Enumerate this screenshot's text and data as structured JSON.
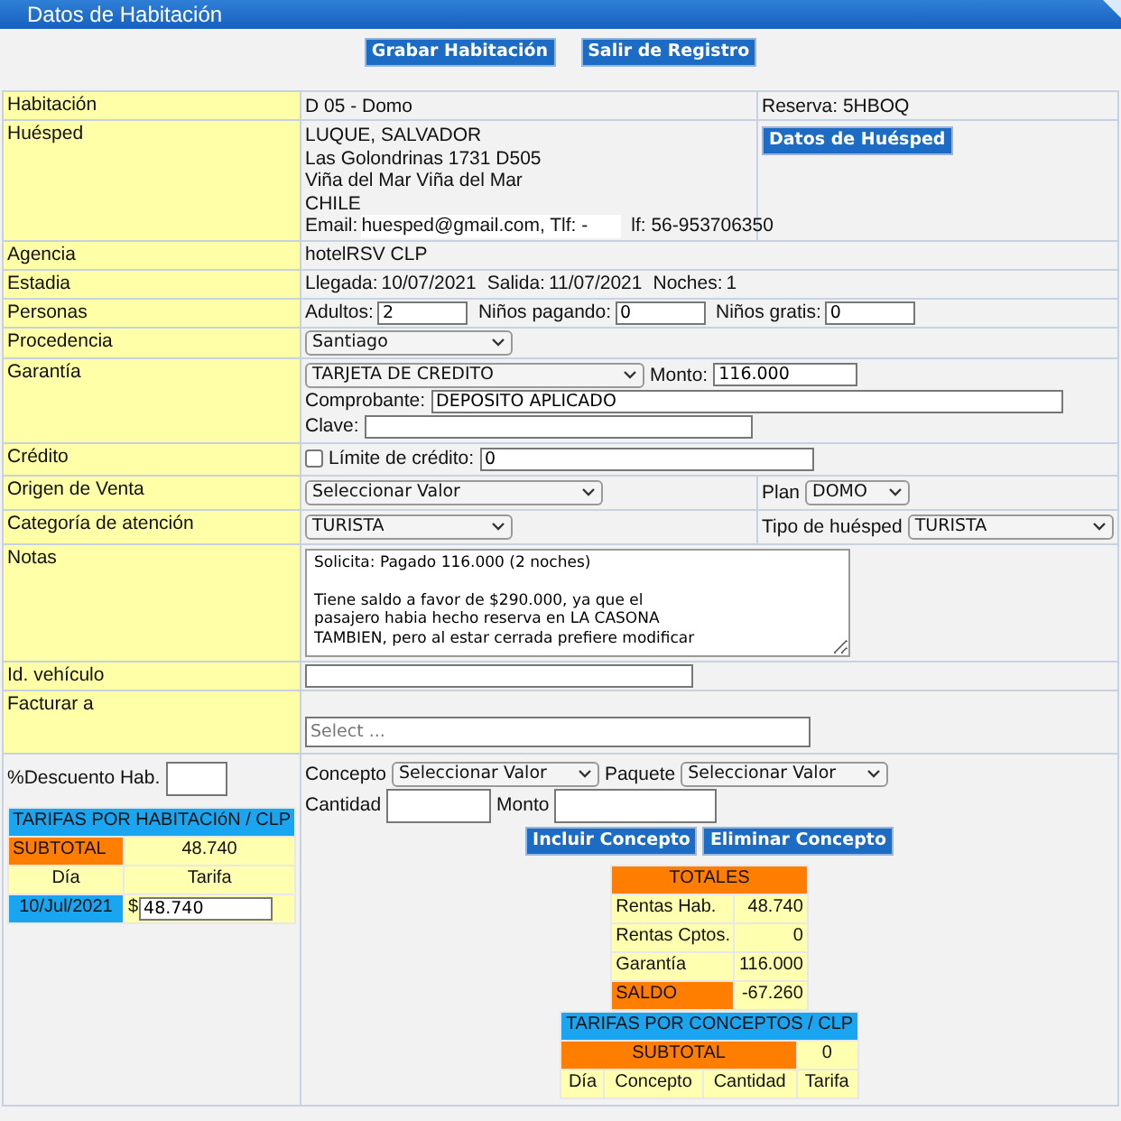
{
  "window": {
    "title": "Datos de Habitación"
  },
  "toolbar": {
    "buttons": [
      "Grabar Habitación",
      "Salir de Registro"
    ]
  },
  "habitacion": {
    "label": "Habitación",
    "value": "D 05 - Domo",
    "reserva_label": "Reserva:",
    "reserva": "5HBOQ"
  },
  "huesped": {
    "label": "Huésped",
    "lines": [
      "LUQUE, SALVADOR",
      "Las Golondrinas 1731 D505",
      "Viña del Mar Viña del Mar",
      "CHILE"
    ],
    "email_label": "Email:",
    "email": "huesped@gmail.com, Tlf: -",
    "phone": "lf: 56-953706350",
    "button": "Datos de Huésped"
  },
  "agencia": {
    "label": "Agencia",
    "value": "hotelRSV CLP"
  },
  "estadia": {
    "label": "Estadia",
    "items": [
      {
        "label": "Llegada:",
        "value": "10/07/2021"
      },
      {
        "label": "Salida:",
        "value": "11/07/2021"
      },
      {
        "label": "Noches:",
        "value": "1"
      }
    ]
  },
  "personas": {
    "label": "Personas",
    "fields": [
      {
        "label": "Adultos:",
        "value": "2"
      },
      {
        "label": "Niños pagando:",
        "value": "0"
      },
      {
        "label": "Niños gratis:",
        "value": "0"
      }
    ]
  },
  "procedencia": {
    "label": "Procedencia",
    "select": "Santiago"
  },
  "garantia": {
    "label": "Garantía",
    "select": "TARJETA DE CREDITO",
    "monto_label": "Monto:",
    "monto": "116.000",
    "comprobante_label": "Comprobante:",
    "comprobante": "DEPOSITO APLICADO",
    "clave_label": "Clave:"
  },
  "credito": {
    "label": "Crédito",
    "checkbox_label": "Límite de crédito:",
    "checked": false,
    "value": "0"
  },
  "origen": {
    "label": "Origen de Venta",
    "select": "Seleccionar Valor",
    "plan_label": "Plan",
    "plan": "DOMO"
  },
  "categoria": {
    "label": "Categoría de atención",
    "select": "TURISTA",
    "tipo_label": "Tipo de huésped",
    "tipo": "TURISTA"
  },
  "notas": {
    "label": "Notas",
    "text": "Solicita: Pagado 116.000 (2 noches)\n\nTiene saldo a favor de $290.000, ya que el\npasajero habia hecho reserva en LA CASONA\nTAMBIEN, pero al estar cerrada prefiere modificar"
  },
  "vehiculo": {
    "label": "Id. vehículo"
  },
  "facturar": {
    "label": "Facturar a",
    "placeholder": "Select ..."
  },
  "descuento": {
    "label": "%Descuento Hab."
  },
  "tarifas_hab": {
    "title": "TARIFAS POR HABITACIóN / CLP",
    "subtotal_label": "SUBTOTAL",
    "subtotal": "48.740",
    "columns": [
      "Día",
      "Tarifa"
    ],
    "rows": [
      {
        "dia": "10/Jul/2021",
        "currency": "$",
        "tarifa": "48.740"
      }
    ]
  },
  "conceptos": {
    "concepto_label": "Concepto",
    "concepto": "Seleccionar Valor",
    "paquete_label": "Paquete",
    "paquete": "Seleccionar Valor",
    "cantidad_label": "Cantidad",
    "monto_label": "Monto",
    "buttons": [
      "Incluir Concepto",
      "Eliminar Concepto"
    ]
  },
  "totales": {
    "title": "TOTALES",
    "rows": [
      {
        "label": "Rentas Hab.",
        "value": "48.740",
        "kind": "normal"
      },
      {
        "label": "Rentas Cptos.",
        "value": "0",
        "kind": "normal"
      },
      {
        "label": "Garantía",
        "value": "116.000",
        "kind": "normal"
      },
      {
        "label": "SALDO",
        "value": "-67.260",
        "kind": "total"
      }
    ]
  },
  "tarifas_conceptos": {
    "title": "TARIFAS POR CONCEPTOS / CLP",
    "subtotal_label": "SUBTOTAL",
    "subtotal": "0",
    "columns": [
      "Día",
      "Concepto",
      "Cantidad",
      "Tarifa"
    ]
  }
}
